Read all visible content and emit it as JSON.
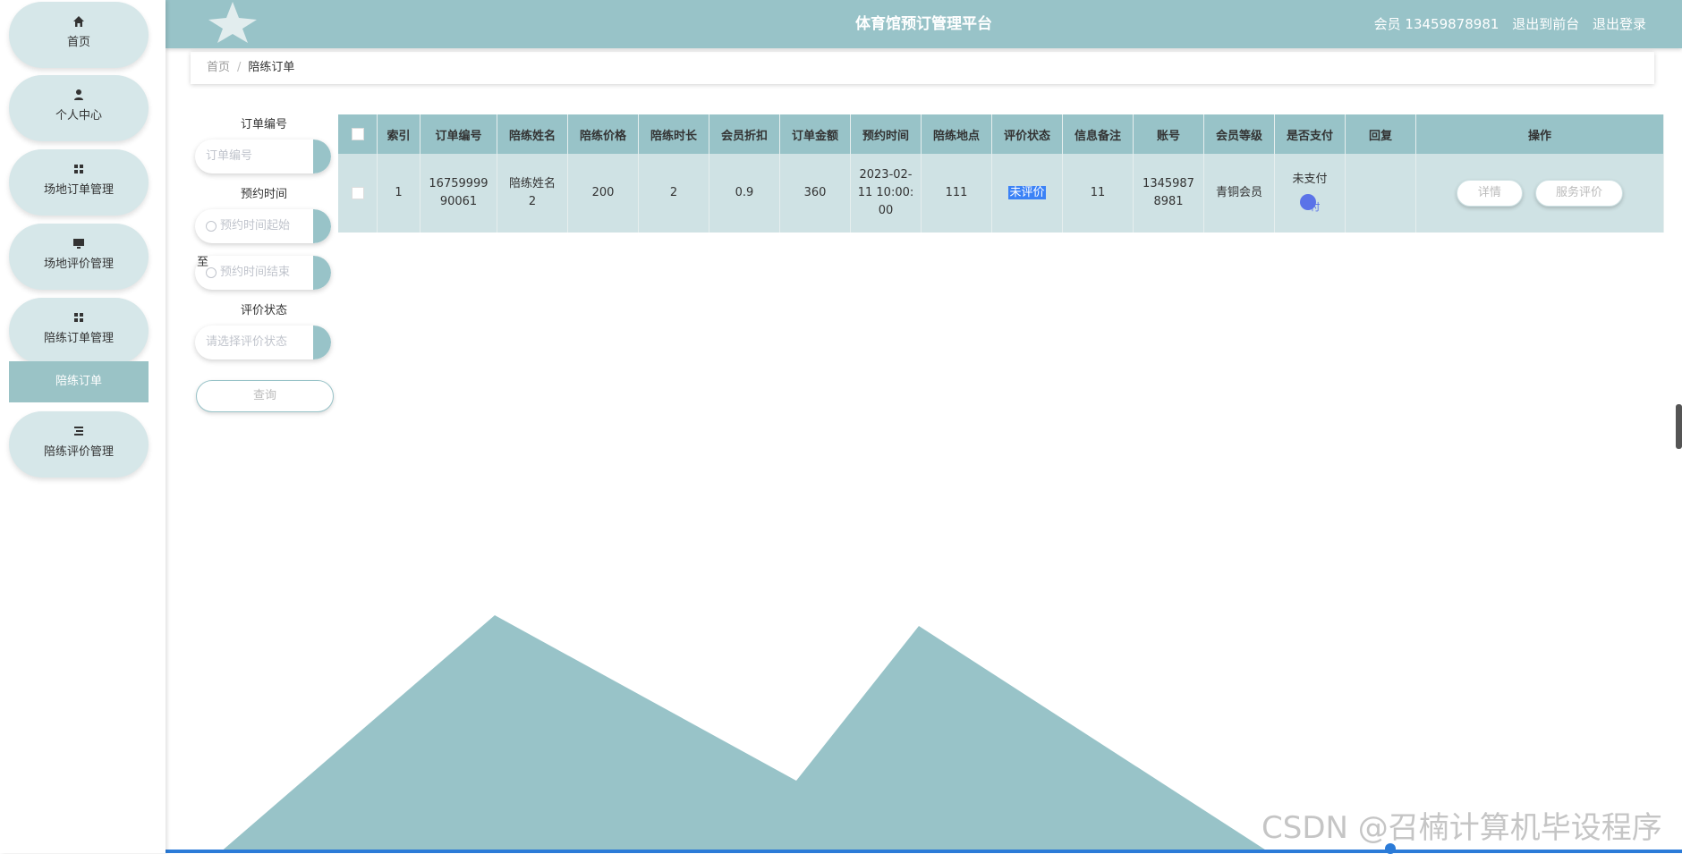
{
  "header": {
    "title": "体育馆预订管理平台",
    "user_label": "会员 13459878981",
    "to_front": "退出到前台",
    "logout": "退出登录"
  },
  "sidebar": {
    "items": [
      {
        "label": "首页",
        "icon": "home-icon"
      },
      {
        "label": "个人中心",
        "icon": "user-icon"
      },
      {
        "label": "场地订单管理",
        "icon": "grid-icon"
      },
      {
        "label": "场地评价管理",
        "icon": "monitor-icon"
      },
      {
        "label": "陪练订单管理",
        "icon": "grid-icon"
      },
      {
        "label": "陪练评价管理",
        "icon": "list-icon"
      }
    ],
    "submenu_active": "陪练订单"
  },
  "breadcrumb": {
    "home": "首页",
    "separator": "/",
    "current": "陪练订单"
  },
  "search": {
    "order_no_label": "订单编号",
    "order_no_placeholder": "订单编号",
    "time_label": "预约时间",
    "time_start_placeholder": "预约时间起始",
    "to": "至",
    "time_end_placeholder": "预约时间结束",
    "eval_label": "评价状态",
    "eval_placeholder": "请选择评价状态",
    "query_button": "查询"
  },
  "table": {
    "headers": [
      "索引",
      "订单编号",
      "陪练姓名",
      "陪练价格",
      "陪练时长",
      "会员折扣",
      "订单金额",
      "预约时间",
      "陪练地点",
      "评价状态",
      "信息备注",
      "账号",
      "会员等级",
      "是否支付",
      "回复",
      "操作"
    ],
    "rows": [
      {
        "index": "1",
        "order_no_a": "16759999",
        "order_no_b": "90061",
        "coach_a": "陪练姓名",
        "coach_b": "2",
        "price": "200",
        "duration": "2",
        "discount": "0.9",
        "amount": "360",
        "time_a": "2023-02-",
        "time_b": "11 10:00:",
        "time_c": "00",
        "location": "111",
        "eval_status": "未评价",
        "remark": "11",
        "account_a": "1345987",
        "account_b": "8981",
        "level": "青铜会员",
        "paid": "未支付",
        "pay_link_fragment": "付",
        "reply": "",
        "detail_button": "详情",
        "service_eval_button": "服务评价"
      }
    ]
  },
  "watermark": "CSDN @召楠计算机毕设程序",
  "colors": {
    "primary": "#98c3c8",
    "row_bg": "#cfe2e4",
    "menu_bg": "#d6e7e9",
    "highlight": "#3b82f6"
  }
}
